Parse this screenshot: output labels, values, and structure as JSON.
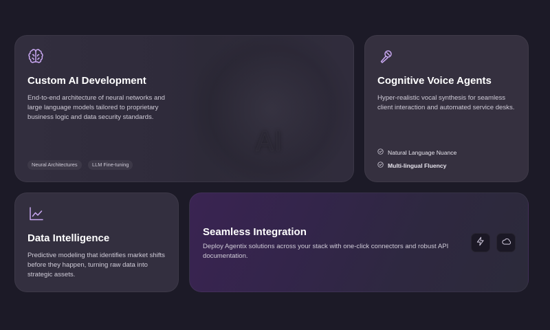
{
  "cards": {
    "custom_ai": {
      "icon": "brain-icon",
      "title": "Custom AI Development",
      "description": "End-to-end architecture of neural networks and large language models tailored to proprietary business logic and data security standards.",
      "tags": [
        "Neural Architectures",
        "LLM Fine-tuning"
      ],
      "visual_text": "AI"
    },
    "voice": {
      "icon": "microphone-icon",
      "title": "Cognitive Voice Agents",
      "description": "Hyper-realistic vocal synthesis for seamless client interaction and automated service desks.",
      "features": [
        "Natural Language Nuance",
        "Multi-lingual Fluency"
      ]
    },
    "data": {
      "icon": "line-chart-icon",
      "title": "Data Intelligence",
      "description": "Predictive modeling that identifies market shifts before they happen, turning raw data into strategic assets."
    },
    "integration": {
      "title": "Seamless Integration",
      "description": "Deploy Agentix solutions across your stack with one-click connectors and robust API documentation.",
      "actions": [
        "lightning-icon",
        "cloud-icon"
      ]
    }
  },
  "colors": {
    "background": "#1c1a27",
    "accent": "#c9a8f2",
    "card": "#302c3c"
  }
}
